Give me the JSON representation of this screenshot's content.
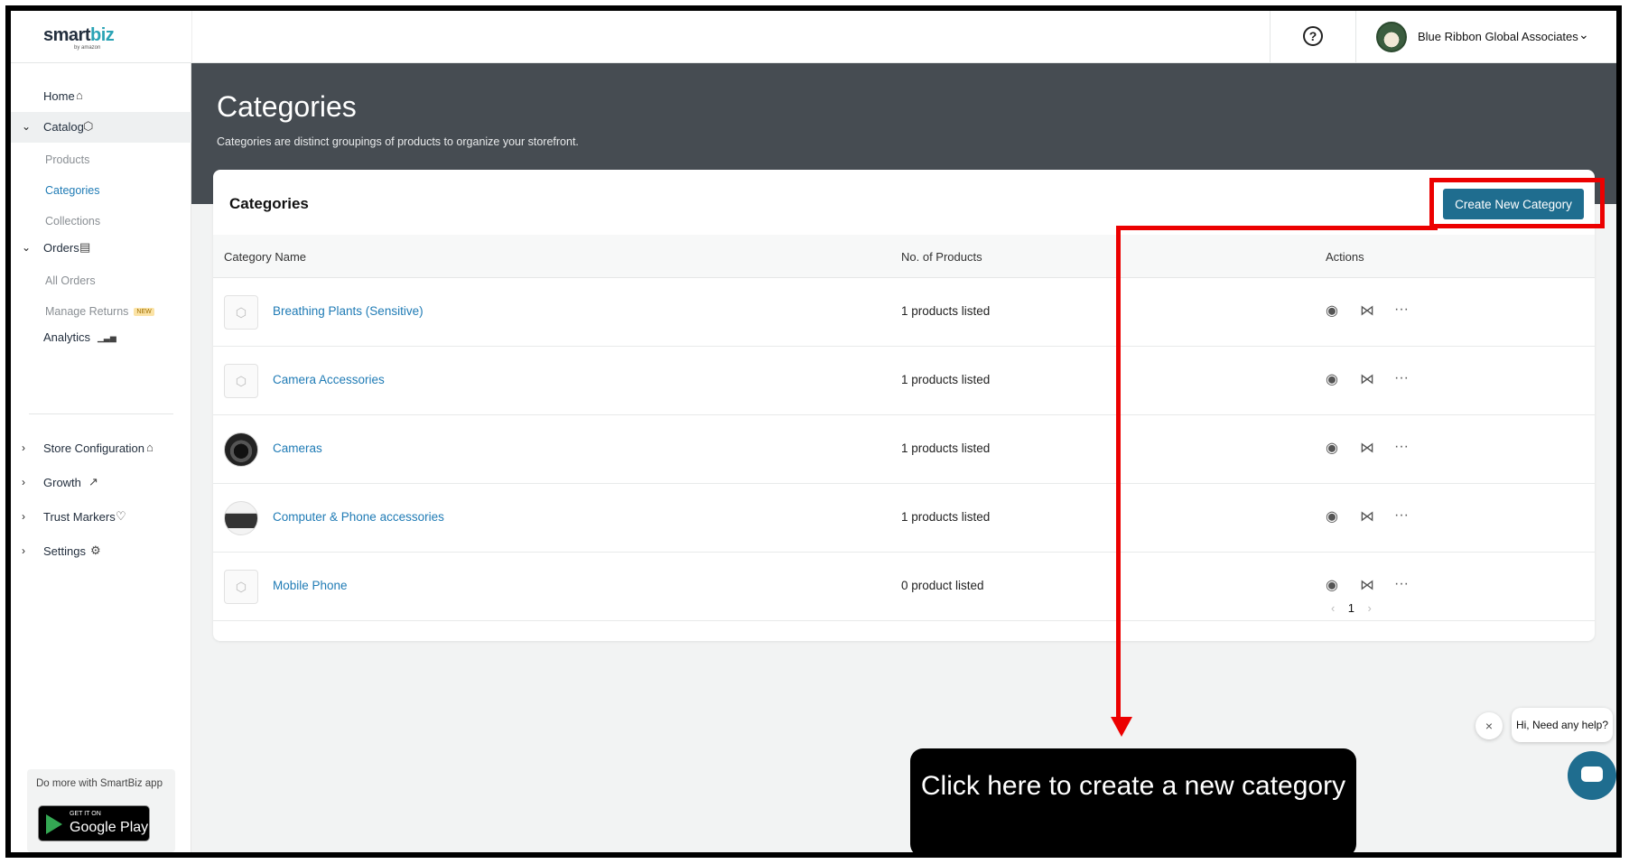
{
  "app": {
    "logo_main": "smart",
    "logo_accent": "biz",
    "logo_sub": "by amazon"
  },
  "topbar": {
    "help_icon": "?",
    "company_name": "Blue Ribbon Global Associates",
    "dropdown_icon": "⌄"
  },
  "sidebar": {
    "items": [
      {
        "label": "Home",
        "icon": "home-icon",
        "glyph": "⌂"
      },
      {
        "label": "Catalog",
        "icon": "box-icon",
        "glyph": "⬡"
      },
      {
        "label": "Orders",
        "icon": "clipboard-icon",
        "glyph": "▤"
      },
      {
        "label": "Analytics",
        "icon": "bar-chart-icon",
        "glyph": "▁▃▅"
      }
    ],
    "catalog_sub": [
      "Products",
      "Categories",
      "Collections"
    ],
    "orders_sub": [
      "All Orders",
      "Manage Returns"
    ],
    "new_badge": "NEW",
    "sections": [
      {
        "label": "Store Configuration",
        "icon": "store-icon",
        "glyph": "⌂"
      },
      {
        "label": "Growth",
        "icon": "trend-up-icon",
        "glyph": "↗"
      },
      {
        "label": "Trust Markers",
        "icon": "badge-icon",
        "glyph": "♡"
      },
      {
        "label": "Settings",
        "icon": "gear-icon",
        "glyph": "⚙"
      }
    ],
    "promo_text": "Do more with SmartBiz app",
    "gplay_small": "GET IT ON",
    "gplay_big": "Google Play"
  },
  "header": {
    "title": "Categories",
    "subtitle": "Categories are distinct groupings of products to organize your storefront."
  },
  "card": {
    "title": "Categories",
    "create_button": "Create New Category",
    "columns": [
      "Category Name",
      "No. of Products",
      "Actions"
    ],
    "rows": [
      {
        "name": "Breathing Plants (Sensitive)",
        "count": "1 products listed",
        "thumb": "placeholder"
      },
      {
        "name": "Camera Accessories",
        "count": "1 products listed",
        "thumb": "placeholder"
      },
      {
        "name": "Cameras",
        "count": "1 products listed",
        "thumb": "camera-photo"
      },
      {
        "name": "Computer & Phone accessories",
        "count": "1 products listed",
        "thumb": "vr-photo"
      },
      {
        "name": "Mobile Phone",
        "count": "0 product listed",
        "thumb": "placeholder"
      }
    ],
    "actions": {
      "view": "◉",
      "share": "⋈",
      "more": "···"
    },
    "pagination": {
      "prev": "‹",
      "page": "1",
      "next": "›"
    }
  },
  "annotation": {
    "callout_text": "Click here to create a new category",
    "color": "#ec0000"
  },
  "chat": {
    "close": "×",
    "bubble": "Hi, Need any help?"
  }
}
